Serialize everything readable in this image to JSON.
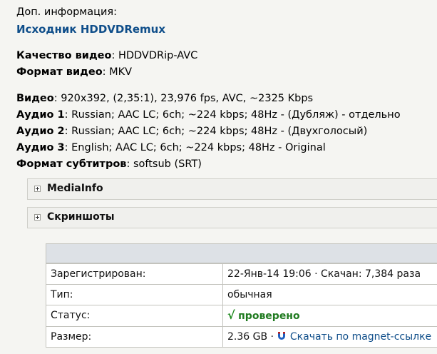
{
  "info": {
    "heading": "Доп. информация:",
    "source_link": "Исходник HDDVDRemux"
  },
  "quality": {
    "video_quality_label": "Качество видео",
    "video_quality_value": ": HDDVDRip-AVC",
    "video_format_label": "Формат видео",
    "video_format_value": ": MKV"
  },
  "tracks": [
    {
      "label": "Видео",
      "value": ": 920x392, (2,35:1), 23,976 fps, AVC, ~2325 Kbps"
    },
    {
      "label": "Аудио 1",
      "value": ": Russian; AAC LC; 6ch; ~224 kbps; 48Hz - (Дубляж) - отдельно"
    },
    {
      "label": "Аудио 2",
      "value": ": Russian; AAC LC; 6ch; ~224 kbps; 48Hz - (Двухголосый)"
    },
    {
      "label": "Аудио 3",
      "value": ": English; AAC LC; 6ch; ~224 kbps; 48Hz - Original"
    },
    {
      "label": "Формат субтитров",
      "value": ": softsub (SRT)"
    }
  ],
  "spoilers": [
    {
      "title": "MediaInfo"
    },
    {
      "title": "Скриншоты"
    }
  ],
  "details": {
    "registered_label": "Зарегистрирован:",
    "registered_value": "22-Янв-14 19:06",
    "downloaded_text": " · Скачан: 7,384 раза",
    "type_label": "Тип:",
    "type_value": "обычная",
    "status_label": "Статус:",
    "status_check": "√",
    "status_value": "проверено",
    "size_label": "Размер:",
    "size_value": "2.36 GB",
    "size_sep": " · ",
    "magnet_link": "Скачать по magnet-ссылке"
  },
  "colors": {
    "link": "#0f4e8a",
    "ok": "#1f8a1f",
    "table_header": "#dde1e6"
  }
}
